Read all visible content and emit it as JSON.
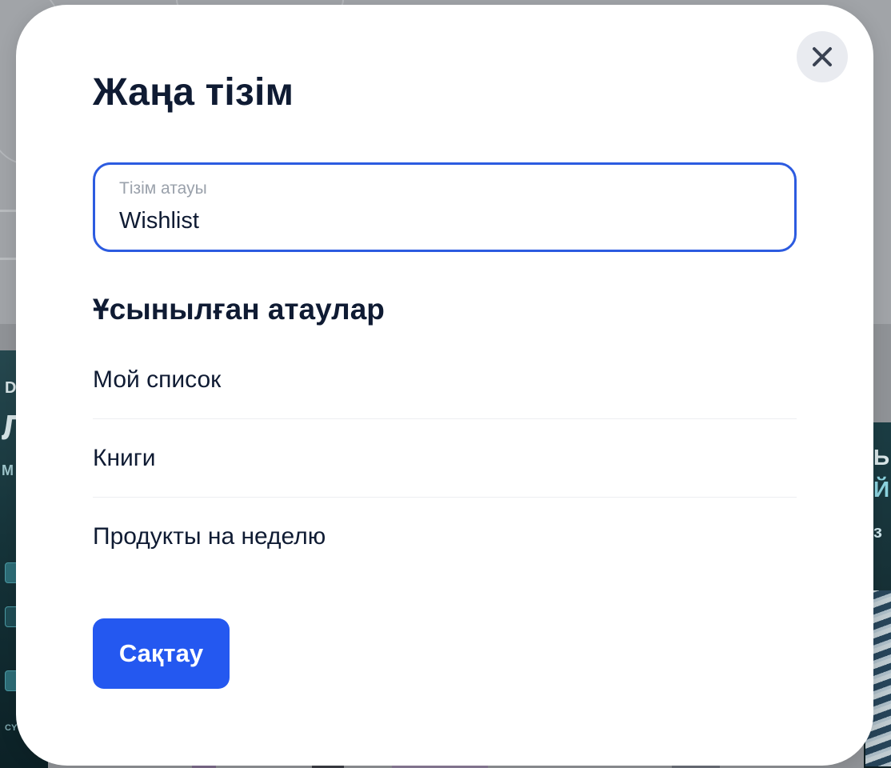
{
  "modal": {
    "title": "Жаңа тізім",
    "close_icon": "close-icon",
    "name_field": {
      "label": "Тізім атауы",
      "value": "Wishlist"
    },
    "suggestions_title": "Ұсынылған атаулар",
    "suggestions": [
      {
        "label": "Мой список"
      },
      {
        "label": "Книги"
      },
      {
        "label": "Продукты на неделю"
      }
    ],
    "save_label": "Сақтау"
  },
  "colors": {
    "accent": "#2458f0",
    "focus_border": "#2c5be0",
    "text_primary": "#0f1b33",
    "text_muted": "#9aa1ab",
    "close_bg": "#e9ebf0"
  }
}
